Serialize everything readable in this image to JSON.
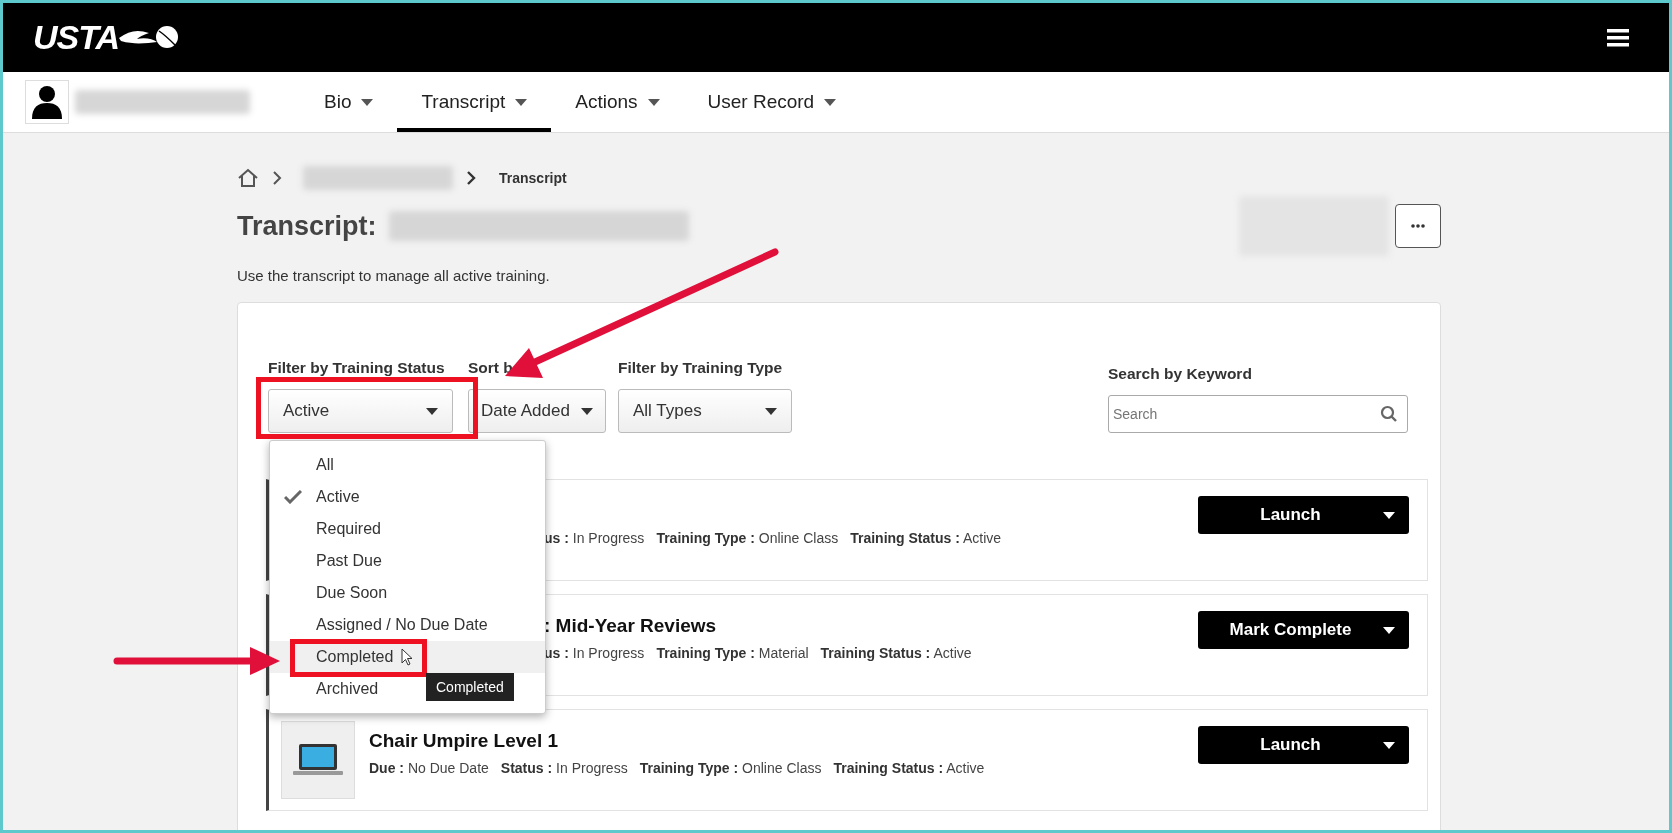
{
  "header": {
    "logo": "USTA"
  },
  "nav_tabs": [
    {
      "label": "Bio",
      "selected": false
    },
    {
      "label": "Transcript",
      "selected": true
    },
    {
      "label": "Actions",
      "selected": false
    },
    {
      "label": "User Record",
      "selected": false
    }
  ],
  "breadcrumb": {
    "current": "Transcript"
  },
  "page": {
    "title": "Transcript:",
    "description": "Use the transcript to manage all active training."
  },
  "filters": [
    {
      "label": "Filter by Training Status",
      "value": "Active"
    },
    {
      "label": "Sort b",
      "value": "Date Added"
    },
    {
      "label": "Filter by Training Type",
      "value": "All Types"
    }
  ],
  "search": {
    "label": "Search by Keyword",
    "placeholder": "Search"
  },
  "status_menu": {
    "items": [
      {
        "label": "All",
        "selected": false,
        "hovered": false
      },
      {
        "label": "Active",
        "selected": true,
        "hovered": false
      },
      {
        "label": "Required",
        "selected": false,
        "hovered": false
      },
      {
        "label": "Past Due",
        "selected": false,
        "hovered": false
      },
      {
        "label": "Due Soon",
        "selected": false,
        "hovered": false
      },
      {
        "label": "Assigned / No Due Date",
        "selected": false,
        "hovered": false
      },
      {
        "label": "Completed",
        "selected": false,
        "hovered": true
      },
      {
        "label": "Archived",
        "selected": false,
        "hovered": false
      }
    ],
    "tooltip": "Completed"
  },
  "rows": [
    {
      "covered": true,
      "meta": [
        {
          "label": "us :",
          "value": "In Progress"
        },
        {
          "label": "Training Type :",
          "value": "Online Class"
        },
        {
          "label": "Training Status :",
          "value": "Active"
        }
      ],
      "action": "Launch"
    },
    {
      "covered": true,
      "title": ": Mid-Year Reviews",
      "meta": [
        {
          "label": "us :",
          "value": "In Progress"
        },
        {
          "label": "Training Type :",
          "value": "Material"
        },
        {
          "label": "Training Status :",
          "value": "Active"
        }
      ],
      "action": "Mark Complete"
    },
    {
      "covered": false,
      "title": "Chair Umpire Level 1",
      "meta": [
        {
          "label": "Due :",
          "value": "No Due Date"
        },
        {
          "label": "Status :",
          "value": "In Progress"
        },
        {
          "label": "Training Type :",
          "value": "Online Class"
        },
        {
          "label": "Training Status :",
          "value": "Active"
        }
      ],
      "action": "Launch"
    }
  ]
}
